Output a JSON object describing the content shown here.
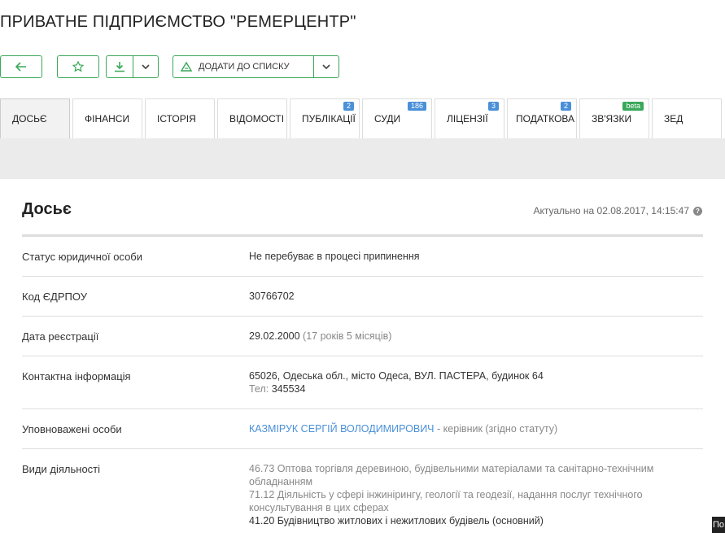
{
  "page": {
    "title": "ПРИВАТНЕ ПІДПРИЄМСТВО \"РЕМЕРЦЕНТР\""
  },
  "toolbar": {
    "back_icon": "arrow-left-icon",
    "favorite_icon": "star-icon",
    "download_icon": "download-icon",
    "add_to_list_label": "ДОДАТИ ДО СПИСКУ",
    "accent_color": "#3aa85a"
  },
  "tabs": [
    {
      "label": "ДОСЬЄ",
      "badge": "",
      "active": true
    },
    {
      "label": "ФІНАНСИ",
      "badge": ""
    },
    {
      "label": "ІСТОРІЯ",
      "badge": ""
    },
    {
      "label": "ВІДОМОСТІ",
      "badge": ""
    },
    {
      "label": "ПУБЛІКАЦІЇ",
      "badge": "2"
    },
    {
      "label": "СУДИ",
      "badge": "186"
    },
    {
      "label": "ЛІЦЕНЗІЇ",
      "badge": "3"
    },
    {
      "label": "ПОДАТКОВА",
      "badge": "2"
    },
    {
      "label": "ЗВ'ЯЗКИ",
      "badge": "beta"
    },
    {
      "label": "ЗЕД",
      "badge": ""
    }
  ],
  "dossier": {
    "title": "Досьє",
    "actual": "Актуально на 02.08.2017, 14:15:47",
    "help": "?",
    "rows": {
      "status": {
        "label": "Статус юридичної особи",
        "value": "Не перебуває в процесі припинення"
      },
      "code": {
        "label": "Код ЄДРПОУ",
        "value": "30766702"
      },
      "reg_date": {
        "label": "Дата реєстрації",
        "value": "29.02.2000",
        "extra": "(17 років 5 місяців)"
      },
      "contact": {
        "label": "Контактна інформація",
        "address": "65026, Одеська обл., місто Одеса, ВУЛ. ПАСТЕРА, будинок 64",
        "phone_label": "Тел:",
        "phone": "345534"
      },
      "persons": {
        "label": "Уповноважені особи",
        "name": "КАЗМІРУК СЕРГІЙ ВОЛОДИМИРОВИЧ",
        "role": "- керівник (згідно статуту)"
      },
      "activities": {
        "label": "Види діяльності",
        "items": [
          "46.73 Оптова торгівля деревиною, будівельними матеріалами та санітарно-технічним обладнанням",
          "71.12 Діяльність у сфері інжинірингу, геології та геодезії, надання послуг технічного консультування в цих сферах",
          "41.20 Будівництво житлових і нежитлових будівель (основний)"
        ]
      }
    }
  },
  "corner": "По"
}
